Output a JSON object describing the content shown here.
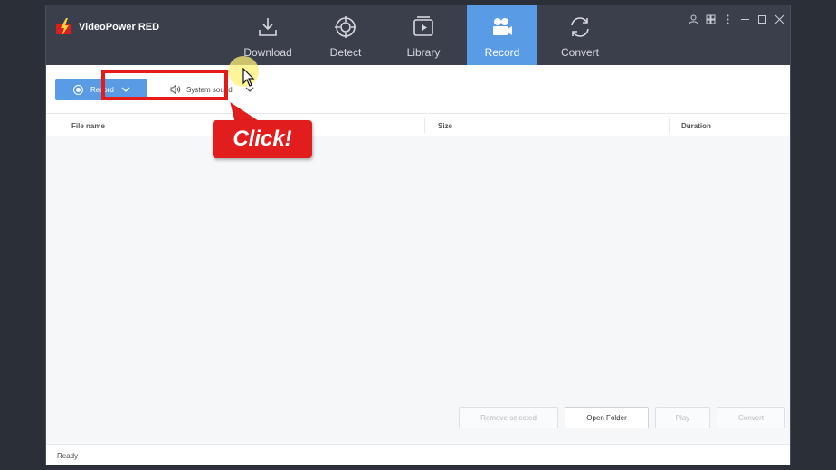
{
  "app": {
    "title": "VideoPower RED"
  },
  "tabs": [
    {
      "label": "Download",
      "icon": "download-icon",
      "active": false
    },
    {
      "label": "Detect",
      "icon": "detect-icon",
      "active": false
    },
    {
      "label": "Library",
      "icon": "library-icon",
      "active": false
    },
    {
      "label": "Record",
      "icon": "video-camera-icon",
      "active": true
    },
    {
      "label": "Convert",
      "icon": "convert-icon",
      "active": false
    }
  ],
  "toolbar": {
    "record_label": "Record",
    "sound_label": "System sound"
  },
  "annotation": {
    "callout_text": "Click!"
  },
  "table": {
    "headers": [
      "File name",
      "Size",
      "Duration"
    ]
  },
  "actions": {
    "remove_selected": "Remove selected",
    "open_folder": "Open Folder",
    "play": "Play",
    "convert": "Convert"
  },
  "status": {
    "text": "Ready"
  },
  "colors": {
    "titlebar": "#3a3f4b",
    "accent": "#5a9be6",
    "highlight": "#e51b1b"
  }
}
